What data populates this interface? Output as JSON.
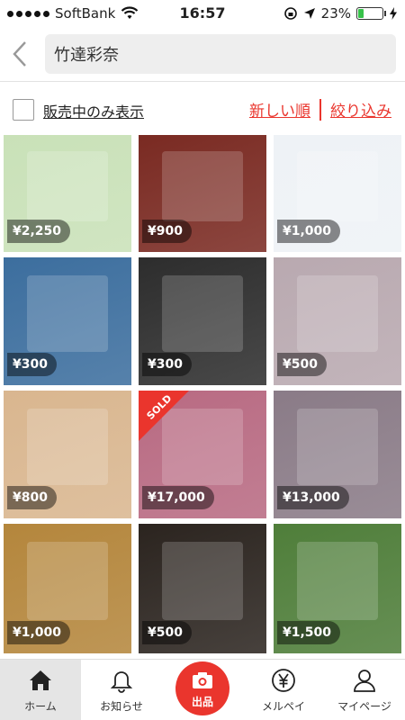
{
  "status_bar": {
    "carrier": "SoftBank",
    "time": "16:57",
    "battery": "23%",
    "battery_level": 0.23
  },
  "search": {
    "query": "竹達彩奈"
  },
  "filter": {
    "on_sale_only_label": "販売中のみ表示",
    "sort_new_label": "新しい順",
    "refine_label": "絞り込み"
  },
  "items": [
    {
      "price": "¥2,250",
      "sold": false,
      "bg": "#c9e1b8"
    },
    {
      "price": "¥900",
      "sold": false,
      "bg": "#7a2a22"
    },
    {
      "price": "¥1,000",
      "sold": false,
      "bg": "#eef2f6"
    },
    {
      "price": "¥300",
      "sold": false,
      "bg": "#3c6e9e"
    },
    {
      "price": "¥300",
      "sold": false,
      "bg": "#2d2d2d"
    },
    {
      "price": "¥500",
      "sold": false,
      "bg": "#b9a9b0"
    },
    {
      "price": "¥800",
      "sold": false,
      "bg": "#d9b68f"
    },
    {
      "price": "¥17,000",
      "sold": true,
      "sold_label": "SOLD",
      "bg": "#b86a82"
    },
    {
      "price": "¥13,000",
      "sold": false,
      "bg": "#8a7b87"
    },
    {
      "price": "¥1,000",
      "sold": false,
      "bg": "#b4863c"
    },
    {
      "price": "¥500",
      "sold": false,
      "bg": "#2b241f"
    },
    {
      "price": "¥1,500",
      "sold": false,
      "bg": "#4f7e3a"
    }
  ],
  "tabs": [
    {
      "label": "ホーム",
      "icon": "home-icon",
      "active": true
    },
    {
      "label": "お知らせ",
      "icon": "bell-icon",
      "active": false
    },
    {
      "label": "出品",
      "icon": "camera-icon",
      "active": false
    },
    {
      "label": "メルペイ",
      "icon": "yen-icon",
      "active": false
    },
    {
      "label": "マイページ",
      "icon": "person-icon",
      "active": false
    }
  ],
  "colors": {
    "accent": "#ea352d"
  }
}
